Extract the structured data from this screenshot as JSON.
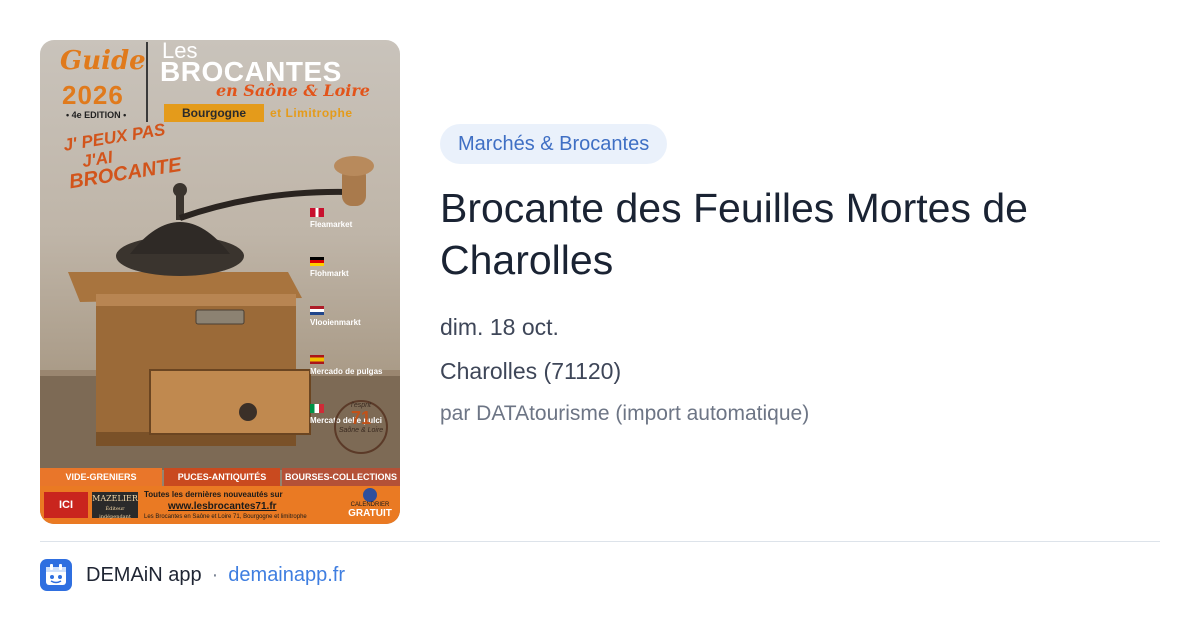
{
  "poster": {
    "guide": "Guide",
    "year": "2026",
    "edition": "• 4e EDITION •",
    "les": "Les",
    "brocantes": "BROCANTES",
    "region": "en Saône & Loire",
    "bourgogne": "Bourgogne",
    "limitrophe": "et Limitrophe",
    "slogan": [
      "J' PEUX PAS",
      "J'AI",
      "BROCANTE"
    ],
    "languages": [
      "Fleamarket",
      "Flohmarkt",
      "Vlooienmarkt",
      "Mercado de pulgas",
      "Mercato delle pulci"
    ],
    "esprit_top": "l'esprit",
    "esprit_num": "71",
    "esprit_bottom": "Saône & Loire",
    "categories": [
      "VIDE-GRENIERS",
      "PUCES-ANTIQUITÉS",
      "BOURSES-COLLECTIONS"
    ],
    "ici": "ICI",
    "mazelier": "MAZELIER",
    "mazelier_sub": "Éditeur indépendant",
    "news": "Toutes les dernières nouveautés sur",
    "url": "www.lesbrocantes71.fr",
    "facebook": "Les Brocantes en Saône et Loire 71, Bourgogne et limitrophe",
    "calendar_label": "CALENDRIER",
    "calendar_free": "GRATUIT"
  },
  "event": {
    "category": "Marchés & Brocantes",
    "title": "Brocante des Feuilles Mortes de Charolles",
    "date": "dim. 18 oct.",
    "location": "Charolles (71120)",
    "source": "par DATAtourisme (import automatique)"
  },
  "footer": {
    "app_name": "DEMAiN app",
    "separator": "·",
    "url": "demainapp.fr"
  },
  "colors": {
    "tag_bg": "#eaf1fb",
    "tag_text": "#3f6fc4",
    "title": "#1a2333",
    "link": "#3f7ee0",
    "poster_orange": "#ea7a23"
  }
}
